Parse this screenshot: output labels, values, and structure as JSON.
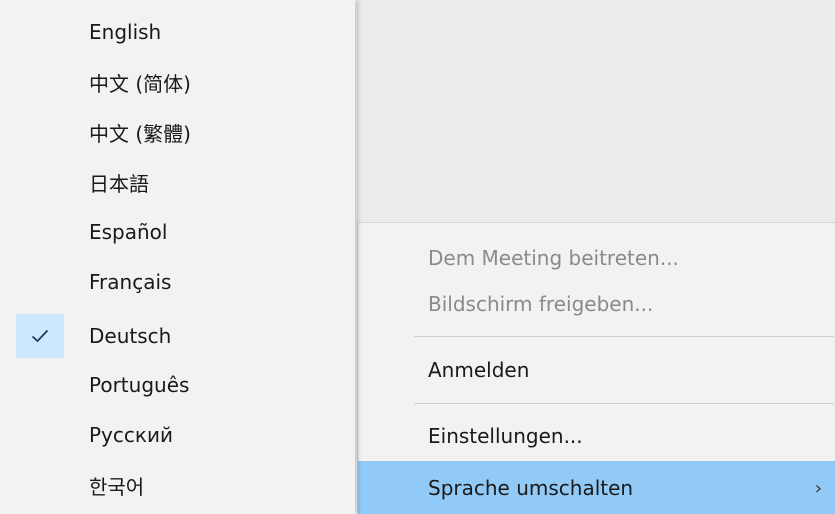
{
  "language_menu": {
    "items": [
      {
        "label": "English",
        "checked": false
      },
      {
        "label": "中文 (简体)",
        "checked": false
      },
      {
        "label": "中文 (繁體)",
        "checked": false
      },
      {
        "label": "日本語",
        "checked": false
      },
      {
        "label": "Español",
        "checked": false
      },
      {
        "label": "Français",
        "checked": false
      },
      {
        "label": "Deutsch",
        "checked": true
      },
      {
        "label": "Português",
        "checked": false
      },
      {
        "label": "Русский",
        "checked": false
      },
      {
        "label": "한국어",
        "checked": false
      }
    ],
    "check_icon": "checkmark-icon"
  },
  "context_menu": {
    "items": [
      {
        "label": "Dem Meeting beitreten...",
        "enabled": false
      },
      {
        "label": "Bildschirm freigeben...",
        "enabled": false
      },
      {
        "label": "Anmelden",
        "enabled": true
      },
      {
        "label": "Einstellungen...",
        "enabled": true
      },
      {
        "label": "Sprache umschalten",
        "enabled": true,
        "highlighted": true,
        "has_submenu": true,
        "arrow": "›"
      }
    ]
  },
  "colors": {
    "menu_bg": "#f2f2f2",
    "highlight": "#91c9f7",
    "check_bg": "#cce8ff",
    "disabled_text": "#8a8a8a"
  }
}
